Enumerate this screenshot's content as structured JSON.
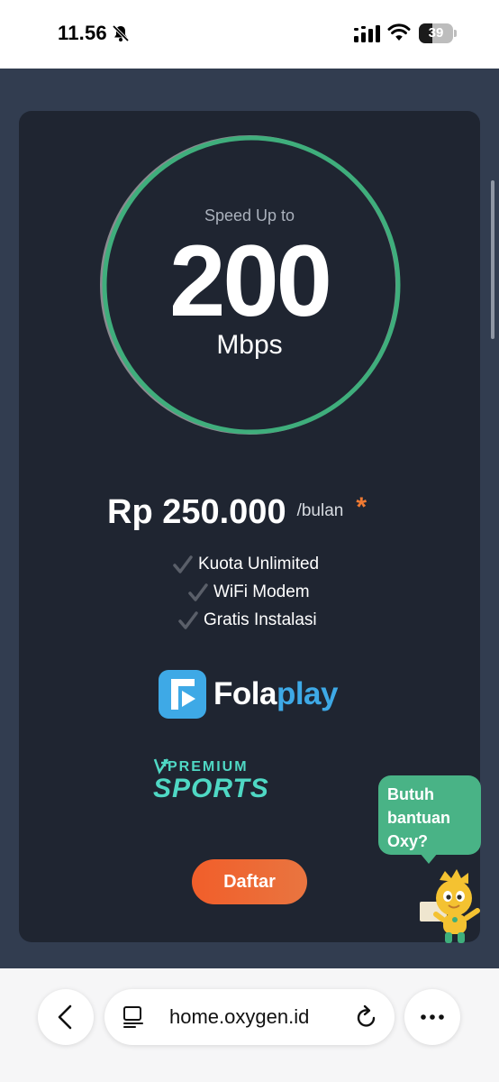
{
  "status_bar": {
    "time": "11.56",
    "battery_level": "39",
    "battery_fraction": 0.39,
    "icons": [
      "bell-slash-icon",
      "cellular-signal-icon",
      "wifi-icon",
      "battery-icon"
    ]
  },
  "plan": {
    "speed_label": "Speed Up to",
    "speed_value": "200",
    "speed_unit": "Mbps",
    "price": "Rp 250.000",
    "period": "/bulan",
    "asterisk": "*",
    "features": [
      "Kuota Unlimited",
      "WiFi Modem",
      "Gratis Instalasi"
    ],
    "partner_1": {
      "part_a": "Fola",
      "part_b": "play"
    },
    "partner_2": {
      "top": "PREMIUM",
      "word": "SPORTS"
    },
    "cta_label": "Daftar"
  },
  "chat": {
    "lines": [
      "Butuh",
      "bantuan",
      "Oxy?"
    ]
  },
  "browser": {
    "url": "home.oxygen.id"
  },
  "colors": {
    "page_background": "#323d50",
    "card_background": "#1f2531",
    "ring_green": "#3fae7c",
    "ring_gray": "#8a8a8f",
    "accent_orange": "#f07a32",
    "folaplay_blue": "#3ea9e6",
    "sports_teal": "#4fd8c4",
    "chat_green": "#49b386"
  }
}
